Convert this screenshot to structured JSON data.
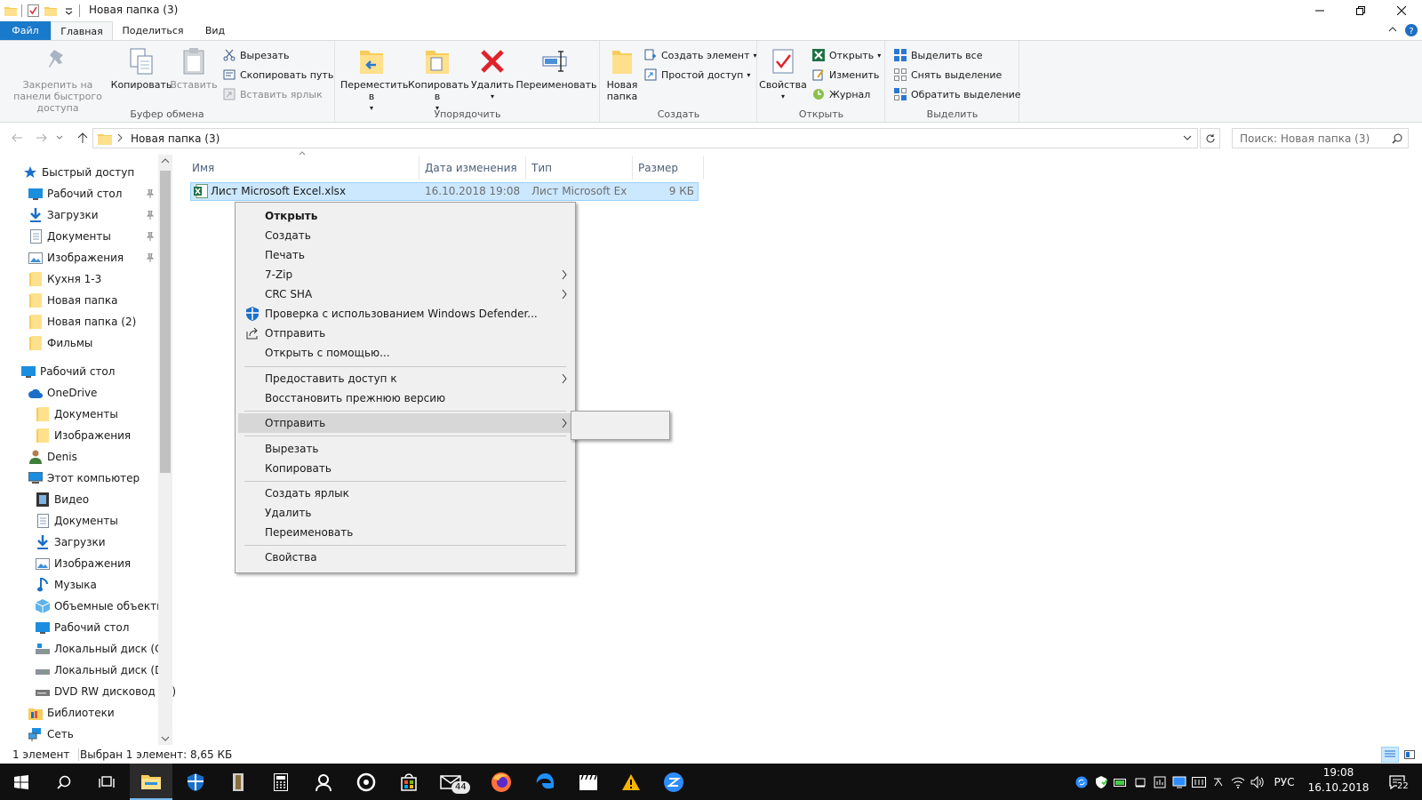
{
  "window": {
    "title": "Новая папка (3)"
  },
  "tabs": [
    {
      "label": "Файл"
    },
    {
      "label": "Главная"
    },
    {
      "label": "Поделиться"
    },
    {
      "label": "Вид"
    }
  ],
  "ribbon": {
    "clipboard": {
      "label": "Буфер обмена",
      "pin": "Закрепить на панели быстрого доступа",
      "copy": "Копировать",
      "paste": "Вставить",
      "cut": "Вырезать",
      "copy_path": "Скопировать путь",
      "paste_shortcut": "Вставить ярлык"
    },
    "organize": {
      "label": "Упорядочить",
      "move": "Переместить в",
      "copy_to": "Копировать в",
      "delete": "Удалить",
      "rename": "Переименовать"
    },
    "create": {
      "label": "Создать",
      "new_folder": "Новая папка",
      "new_item": "Создать элемент",
      "easy_access": "Простой доступ"
    },
    "open": {
      "label": "Открыть",
      "properties": "Свойства",
      "open": "Открыть",
      "edit": "Изменить",
      "history": "Журнал"
    },
    "select": {
      "label": "Выделить",
      "all": "Выделить все",
      "none": "Снять выделение",
      "invert": "Обратить выделение"
    }
  },
  "address": {
    "path": "Новая папка (3)",
    "search_placeholder": "Поиск: Новая папка (3)"
  },
  "nav": {
    "items": [
      {
        "label": "Быстрый доступ",
        "icon": "star-icon"
      },
      {
        "label": "Рабочий стол",
        "icon": "desktop-icon"
      },
      {
        "label": "Загрузки",
        "icon": "download-icon"
      },
      {
        "label": "Документы",
        "icon": "document-icon"
      },
      {
        "label": "Изображения",
        "icon": "image-icon"
      },
      {
        "label": "Кухня 1-3",
        "icon": "folder-icon"
      },
      {
        "label": "Новая папка",
        "icon": "folder-icon"
      },
      {
        "label": "Новая папка (2)",
        "icon": "folder-icon"
      },
      {
        "label": "Фильмы",
        "icon": "folder-icon"
      },
      {
        "label": "Рабочий стол",
        "icon": "desktop-icon"
      },
      {
        "label": "OneDrive",
        "icon": "cloud-icon"
      },
      {
        "label": "Документы",
        "icon": "folder-icon"
      },
      {
        "label": "Изображения",
        "icon": "folder-icon"
      },
      {
        "label": "Denis",
        "icon": "user-icon"
      },
      {
        "label": "Этот компьютер",
        "icon": "computer-icon"
      },
      {
        "label": "Видео",
        "icon": "video-icon"
      },
      {
        "label": "Документы",
        "icon": "document-icon"
      },
      {
        "label": "Загрузки",
        "icon": "download-icon"
      },
      {
        "label": "Изображения",
        "icon": "image-icon"
      },
      {
        "label": "Музыка",
        "icon": "music-icon"
      },
      {
        "label": "Объемные объекты",
        "icon": "cube-icon"
      },
      {
        "label": "Рабочий стол",
        "icon": "desktop-icon"
      },
      {
        "label": "Локальный диск (C:)",
        "icon": "drive-icon"
      },
      {
        "label": "Локальный диск (D:)",
        "icon": "drive-icon"
      },
      {
        "label": "DVD RW дисковод (F:)",
        "icon": "dvd-icon"
      },
      {
        "label": "Библиотеки",
        "icon": "library-icon"
      },
      {
        "label": "Сеть",
        "icon": "network-icon"
      }
    ]
  },
  "columns": {
    "name": "Имя",
    "date": "Дата изменения",
    "type": "Тип",
    "size": "Размер"
  },
  "files": [
    {
      "name": "Лист Microsoft Excel.xlsx",
      "date": "16.10.2018 19:08",
      "type": "Лист Microsoft Ex",
      "size": "9 КБ"
    }
  ],
  "context_menu": {
    "open": "Открыть",
    "create": "Создать",
    "print": "Печать",
    "zip": "7-Zip",
    "crc": "CRC SHA",
    "defender": "Проверка с использованием Windows Defender...",
    "share": "Отправить",
    "open_with": "Открыть с помощью...",
    "give_access": "Предоставить доступ к",
    "restore": "Восстановить прежнюю версию",
    "send_to": "Отправить",
    "cut": "Вырезать",
    "copy": "Копировать",
    "shortcut": "Создать ярлык",
    "delete": "Удалить",
    "rename": "Переименовать",
    "properties": "Свойства"
  },
  "status": {
    "count": "1 элемент",
    "selected": "Выбран 1 элемент: 8,65 КБ"
  },
  "taskbar": {
    "mail_badge": "44",
    "lang": "РУС",
    "time": "19:08",
    "date": "16.10.2018",
    "notif": "22"
  },
  "colors": {
    "accent": "#1979ca",
    "selection": "#cce8ff",
    "taskbar": "#101010"
  }
}
